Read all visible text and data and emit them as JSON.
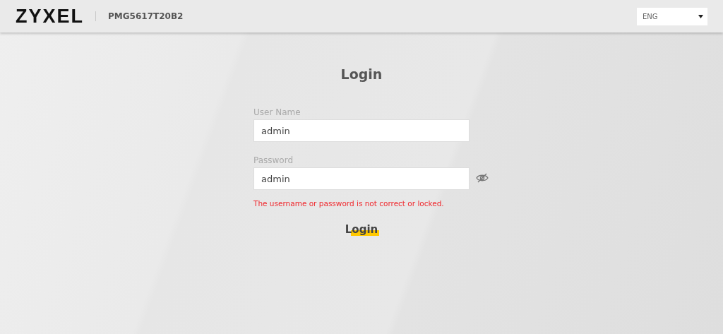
{
  "header": {
    "logo": "ZYXEL",
    "model": "PMG5617T20B2",
    "language": {
      "value": "ENG"
    }
  },
  "login": {
    "title": "Login",
    "fields": [
      {
        "label": "User Name",
        "value": "admin",
        "kind": "text"
      },
      {
        "label": "Password",
        "value": "admin",
        "kind": "password-revealed"
      }
    ],
    "error": "The username or password is not correct or locked.",
    "button": "Login"
  }
}
